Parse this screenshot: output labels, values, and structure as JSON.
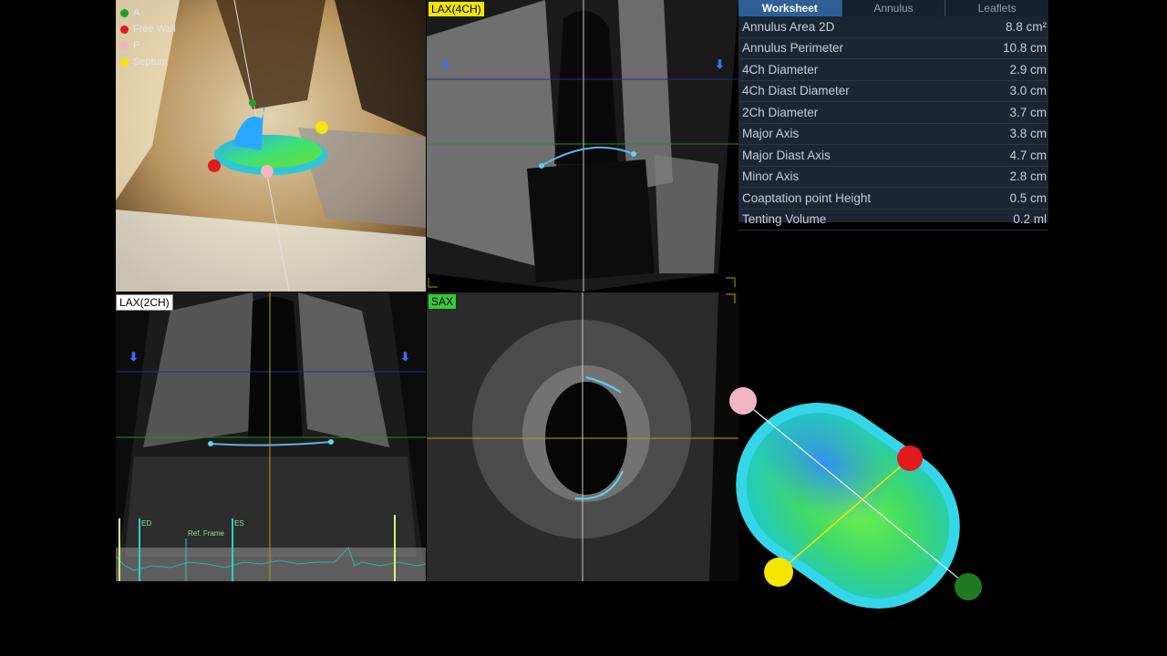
{
  "legend": [
    {
      "label": "A",
      "color": "#1fa02a"
    },
    {
      "label": "Free Wall",
      "color": "#e11b1b"
    },
    {
      "label": "P",
      "color": "#f2b5c4"
    },
    {
      "label": "Septum",
      "color": "#f5e600"
    }
  ],
  "views": {
    "lax4": "LAX(4CH)",
    "lax2": "LAX(2CH)",
    "sax": "SAX"
  },
  "ecg": {
    "ed": "ED",
    "ref": "Ref. Frame",
    "es": "ES"
  },
  "worksheet": {
    "tabs": [
      "Worksheet",
      "Annulus",
      "Leaflets"
    ],
    "active_tab": "Worksheet",
    "rows": [
      {
        "label": "Annulus Area 2D",
        "value": "8.8 cm²"
      },
      {
        "label": "Annulus Perimeter",
        "value": "10.8 cm"
      },
      {
        "label": "4Ch Diameter",
        "value": "2.9 cm"
      },
      {
        "label": "4Ch Diast Diameter",
        "value": "3.0 cm"
      },
      {
        "label": "2Ch Diameter",
        "value": "3.7 cm"
      },
      {
        "label": "Major Axis",
        "value": "3.8 cm"
      },
      {
        "label": "Major Diast Axis",
        "value": "4.7 cm"
      },
      {
        "label": "Minor Axis",
        "value": "2.8 cm"
      },
      {
        "label": "Coaptation point Height",
        "value": "0.5 cm"
      },
      {
        "label": "Tenting Volume",
        "value": "0.2 ml"
      }
    ]
  }
}
